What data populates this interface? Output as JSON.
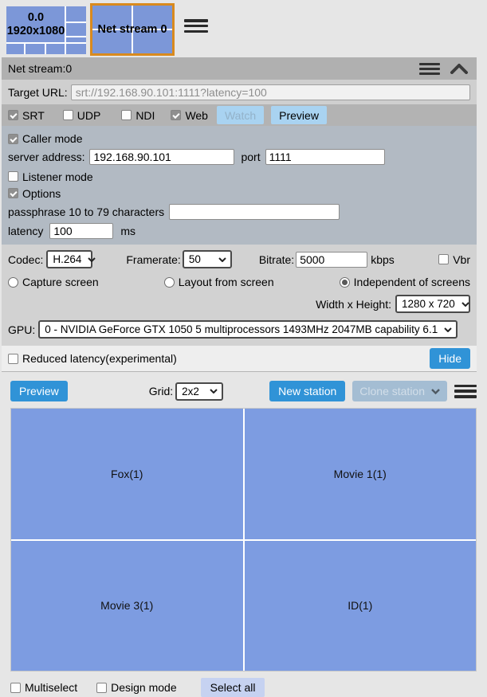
{
  "topbar": {
    "screen_tile": {
      "line1": "0.0",
      "line2": "1920x1080"
    },
    "stream_tile": {
      "label": "Net stream 0"
    }
  },
  "panel": {
    "header": {
      "title": "Net stream:0"
    },
    "target_url": {
      "label": "Target URL:",
      "value": "srt://192.168.90.101:1111?latency=100"
    },
    "protocols": [
      {
        "label": "SRT",
        "checked": true
      },
      {
        "label": "UDP",
        "checked": false
      },
      {
        "label": "NDI",
        "checked": false
      },
      {
        "label": "Web",
        "checked": true
      }
    ],
    "watch_button": "Watch",
    "preview_button": "Preview",
    "caller": {
      "caller_mode": {
        "label": "Caller mode",
        "checked": true
      },
      "server_address": {
        "label": "server address:",
        "value": "192.168.90.101"
      },
      "port": {
        "label": "port",
        "value": "1111"
      },
      "listener_mode": {
        "label": "Listener mode",
        "checked": false
      },
      "options": {
        "label": "Options",
        "checked": true
      },
      "passphrase": {
        "label": "passphrase 10 to 79 characters",
        "value": ""
      },
      "latency": {
        "label": "latency",
        "value": "100",
        "unit": "ms"
      }
    },
    "encoding": {
      "codec": {
        "label": "Codec:",
        "value": "H.264"
      },
      "framerate": {
        "label": "Framerate:",
        "value": "50"
      },
      "bitrate": {
        "label": "Bitrate:",
        "value": "5000",
        "unit": "kbps"
      },
      "vbr": {
        "label": "Vbr",
        "checked": false
      },
      "capture_modes": [
        {
          "label": "Capture screen",
          "selected": false
        },
        {
          "label": "Layout from screen",
          "selected": false
        },
        {
          "label": "Independent of screens",
          "selected": true
        }
      ],
      "resolution": {
        "label": "Width x Height:",
        "value": "1280 x 720"
      },
      "gpu": {
        "label": "GPU:",
        "value": "0 - NVIDIA GeForce GTX 1050 5 multiprocessors 1493MHz 2047MB capability 6.1"
      }
    },
    "reduced_latency": {
      "label": "Reduced latency(experimental)",
      "checked": false
    },
    "hide_button": "Hide"
  },
  "stations": {
    "preview_button": "Preview",
    "grid": {
      "label": "Grid:",
      "value": "2x2"
    },
    "new_station_button": "New station",
    "clone_station_button": "Clone station",
    "tiles": [
      "Fox(1)",
      "Movie 1(1)",
      "Movie 3(1)",
      "ID(1)"
    ],
    "multiselect": {
      "label": "Multiselect",
      "checked": false
    },
    "design_mode": {
      "label": "Design mode",
      "checked": false
    },
    "select_all_button": "Select all"
  },
  "icons": {
    "menu": "hamburger-icon",
    "collapse": "chevron-up-icon",
    "dropdown": "chevron-down-icon"
  },
  "colors": {
    "accent_blue": "#3093d7",
    "light_blue_button": "#a9d3f1",
    "muted_button": "#a4bdd3",
    "lavender_button": "#c6d2f1",
    "tile_blue": "#7d9ce1",
    "thumb_blue": "#7c97d8",
    "selected_border_orange": "#d98a1e",
    "caller_section_bg": "#b2bac3",
    "header_bg": "#b0b0b0"
  }
}
